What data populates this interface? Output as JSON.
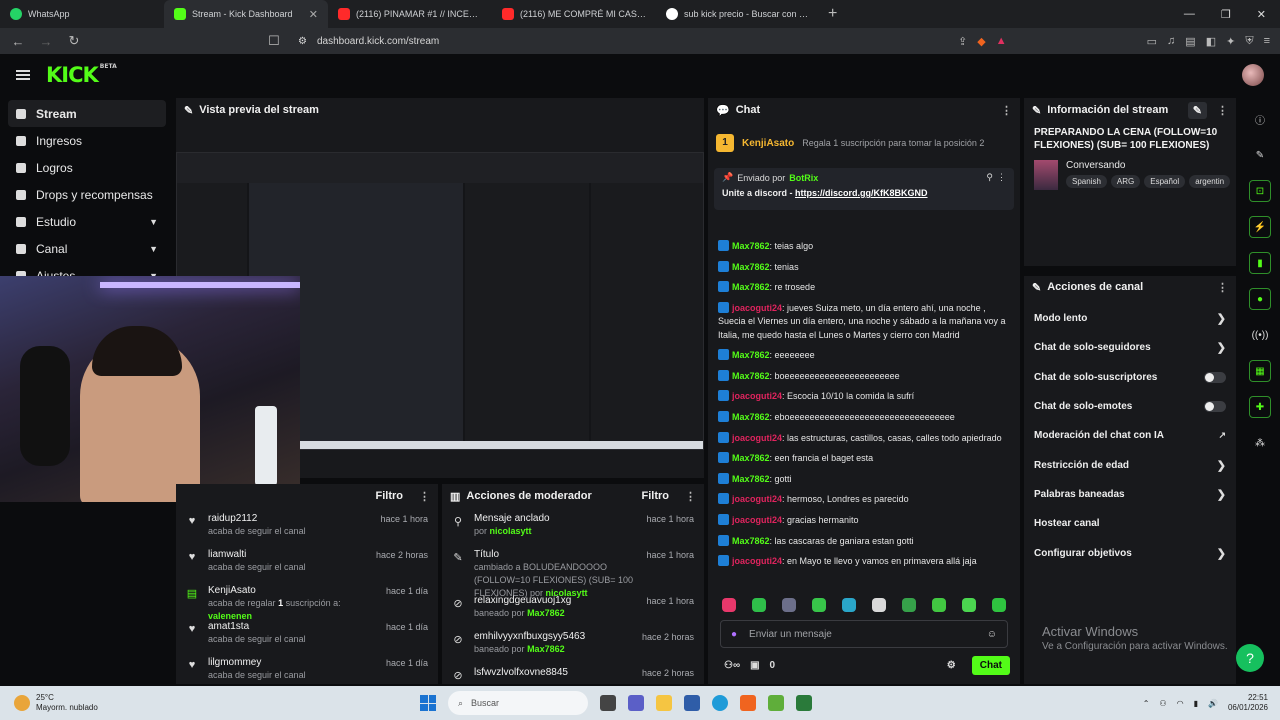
{
  "browser": {
    "tabs": [
      {
        "title": "WhatsApp",
        "color": "#25d366",
        "active": false
      },
      {
        "title": "Stream - Kick Dashboard",
        "color": "#53fc18",
        "active": true
      },
      {
        "title": "(2116) PINAMAR #1 // INCENDIO EN",
        "color": "#ff2a2a",
        "active": false
      },
      {
        "title": "(2116) ME COMPRÉ MI CASA LES MU",
        "color": "#ff2a2a",
        "active": false
      },
      {
        "title": "sub kick precio - Buscar con Google",
        "color": "#ffffff",
        "active": false
      }
    ],
    "url": "dashboard.kick.com/stream"
  },
  "kick": {
    "logo": "KICK",
    "beta": "BETA"
  },
  "sidebar": {
    "items": [
      {
        "label": "Stream",
        "icon": "stream-icon"
      },
      {
        "label": "Ingresos",
        "icon": "revenue-icon"
      },
      {
        "label": "Logros",
        "icon": "achievements-icon"
      },
      {
        "label": "Drops y recompensas",
        "icon": "drops-icon"
      },
      {
        "label": "Estudio",
        "icon": "studio-icon"
      },
      {
        "label": "Canal",
        "icon": "channel-icon"
      },
      {
        "label": "Ajustes",
        "icon": "settings-icon"
      }
    ]
  },
  "preview": {
    "title": "Vista previa del stream"
  },
  "follows": {
    "filter": "Filtro",
    "events": [
      {
        "name": "raidup2112",
        "sub": "acaba de seguir el canal",
        "time": "hace 1 hora"
      },
      {
        "name": "liamwalti",
        "sub": "acaba de seguir el canal",
        "time": "hace 2 horas"
      },
      {
        "name": "KenjiAsato",
        "sub_pre": "acaba de regalar",
        "sub_count": "1",
        "sub_mid": "suscripción a:",
        "sub_target": "valenenen",
        "time": "hace 1 día"
      },
      {
        "name": "amat1sta",
        "sub": "acaba de seguir el canal",
        "time": "hace 1 día"
      },
      {
        "name": "lilgmommey",
        "sub": "acaba de seguir el canal",
        "time": "hace 1 día"
      }
    ]
  },
  "moderator": {
    "title": "Acciones de moderador",
    "filter": "Filtro",
    "events": [
      {
        "name": "Mensaje anclado",
        "sub": "por",
        "by": "nicolasytt",
        "time": "hace 1 hora"
      },
      {
        "name": "Título",
        "sub": "cambiado a BOLUDEANDOOOO (FOLLOW=10 FLEXIONES) (SUB= 100 FLEXIONES) por",
        "by": "nicolasytt",
        "time": "hace 1 hora"
      },
      {
        "name": "relaxingdgeuavuoj1xg",
        "sub": "baneado por",
        "by": "Max7862",
        "time": "hace 1 hora"
      },
      {
        "name": "emhilvyyxnfbuxgsyy5463",
        "sub": "baneado por",
        "by": "Max7862",
        "time": "hace 2 horas"
      },
      {
        "name": "lsfwvzlvolfxovne8845",
        "sub": "",
        "by": "",
        "time": "hace 2 horas"
      }
    ]
  },
  "chat": {
    "title": "Chat",
    "gift": {
      "user": "KenjiAsato",
      "text": "Regala 1 suscripción para tomar la posición 2"
    },
    "pinned": {
      "by_label": "Enviado por",
      "by_user": "BotRix",
      "text": "Unite a discord - ",
      "link": "https://discord.gg/KfK8BKGND"
    },
    "messages": [
      {
        "user": "Max7862",
        "color": "#53fc18",
        "text": "teias algo"
      },
      {
        "user": "Max7862",
        "color": "#53fc18",
        "text": "tenias"
      },
      {
        "user": "Max7862",
        "color": "#53fc18",
        "text": "re trosede"
      },
      {
        "user": "joacoguti24",
        "color": "#e0245e",
        "text": "jueves Suiza meto, un día entero ahí, una noche , Suecia el Viernes un día entero, una noche y sábado a la mañana voy a Italia, me quedo hasta el Lunes o Martes y cierro con Madrid"
      },
      {
        "user": "Max7862",
        "color": "#53fc18",
        "text": "eeeeeeee"
      },
      {
        "user": "Max7862",
        "color": "#53fc18",
        "text": "boeeeeeeeeeeeeeeeeeeeeeee"
      },
      {
        "user": "joacoguti24",
        "color": "#e0245e",
        "text": "Escocia 10/10 la comida la sufrí"
      },
      {
        "user": "Max7862",
        "color": "#53fc18",
        "text": "eboeeeeeeeeeeeeeeeeeeeeeeeeeeeeeeeee"
      },
      {
        "user": "joacoguti24",
        "color": "#e0245e",
        "text": "las estructuras, castillos, casas, calles todo apiedrado"
      },
      {
        "user": "Max7862",
        "color": "#53fc18",
        "text": "een francia el baget esta"
      },
      {
        "user": "Max7862",
        "color": "#53fc18",
        "text": "gotti"
      },
      {
        "user": "joacoguti24",
        "color": "#e0245e",
        "text": "hermoso, Londres es parecido"
      },
      {
        "user": "joacoguti24",
        "color": "#e0245e",
        "text": "gracias hermanito"
      },
      {
        "user": "Max7862",
        "color": "#53fc18",
        "text": "las cascaras de ganiara estan gotti"
      },
      {
        "user": "joacoguti24",
        "color": "#e0245e",
        "text": "en Mayo te llevo y vamos en primavera allá jaja"
      }
    ],
    "input_placeholder": "Enviar un mensaje",
    "viewers": "0",
    "send_label": "Chat"
  },
  "stream_info": {
    "title": "Información del stream",
    "stream_title": "PREPARANDO LA CENA (FOLLOW=10 FLEXIONES) (SUB= 100 FLEXIONES)",
    "category": "Conversando",
    "tags": [
      "Spanish",
      "ARG",
      "Español",
      "argentin"
    ]
  },
  "channel_actions": {
    "title": "Acciones de canal",
    "items": [
      {
        "label": "Modo lento",
        "control": "arrow"
      },
      {
        "label": "Chat de solo-seguidores",
        "control": "arrow"
      },
      {
        "label": "Chat de solo-suscriptores",
        "control": "toggle"
      },
      {
        "label": "Chat de solo-emotes",
        "control": "toggle"
      },
      {
        "label": "Moderación del chat con IA",
        "control": "link"
      },
      {
        "label": "Restricción de edad",
        "control": "arrow"
      },
      {
        "label": "Palabras baneadas",
        "control": "arrow"
      },
      {
        "label": "Hostear canal",
        "control": "none"
      },
      {
        "label": "Configurar objetivos",
        "control": "arrow"
      }
    ]
  },
  "watermark": {
    "line1": "Activar Windows",
    "line2": "Ve a Configuración para activar Windows."
  },
  "taskbar": {
    "temp": "25°C",
    "weather": "Mayorm. nublado",
    "search": "Buscar",
    "time": "22:51",
    "date": "06/01/2026"
  }
}
